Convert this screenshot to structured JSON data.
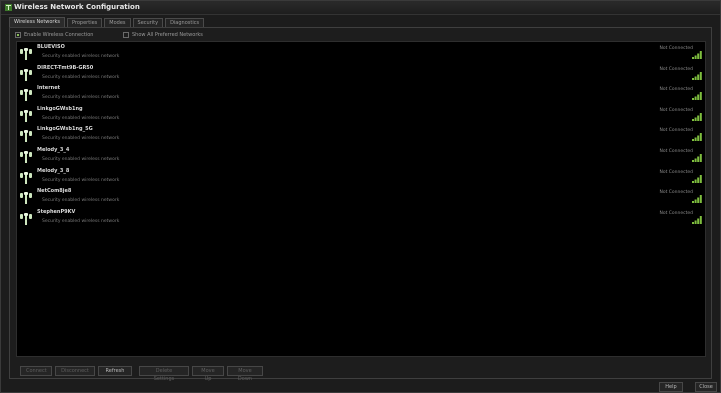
{
  "window": {
    "title": "Wireless Network Configuration"
  },
  "tabs": [
    "Wireless Networks",
    "Properties",
    "Modes",
    "Security",
    "Diagnostics"
  ],
  "options": {
    "enable_wireless": {
      "label": "Enable Wireless Connection",
      "checked": true
    },
    "show_preferred": {
      "label": "Show All Preferred Networks",
      "checked": false
    }
  },
  "networks": [
    {
      "ssid": "BLUEVISO",
      "description": "Security enabled wireless network",
      "status": "Not Connected"
    },
    {
      "ssid": "DIRECT-Tmt9B-GR50",
      "description": "Security enabled wireless network",
      "status": "Not Connected"
    },
    {
      "ssid": "Internet",
      "description": "Security enabled wireless network",
      "status": "Not Connected"
    },
    {
      "ssid": "LinkgoGWsb1ng",
      "description": "Security enabled wireless network",
      "status": "Not Connected"
    },
    {
      "ssid": "LinkgoGWsb1ng_5G",
      "description": "Security enabled wireless network",
      "status": "Not Connected"
    },
    {
      "ssid": "Melody_3_4",
      "description": "Security enabled wireless network",
      "status": "Not Connected"
    },
    {
      "ssid": "Melody_3_8",
      "description": "Security enabled wireless network",
      "status": "Not Connected"
    },
    {
      "ssid": "NetCom8je8",
      "description": "Security enabled wireless network",
      "status": "Not Connected"
    },
    {
      "ssid": "StephenP9KV",
      "description": "Security enabled wireless network",
      "status": "Not Connected"
    }
  ],
  "buttons": {
    "connect": "Connect",
    "disconnect": "Disconnect",
    "refresh": "Refresh",
    "delete_settings": "Delete Settings",
    "move_up": "Move Up",
    "move_down": "Move Down"
  },
  "footer": {
    "help": "Help",
    "close": "Close"
  },
  "colors": {
    "background": "#1c1c1c",
    "list_bg": "#000000",
    "signal": "#7fbf3f",
    "accent": "#8bbf5a"
  }
}
